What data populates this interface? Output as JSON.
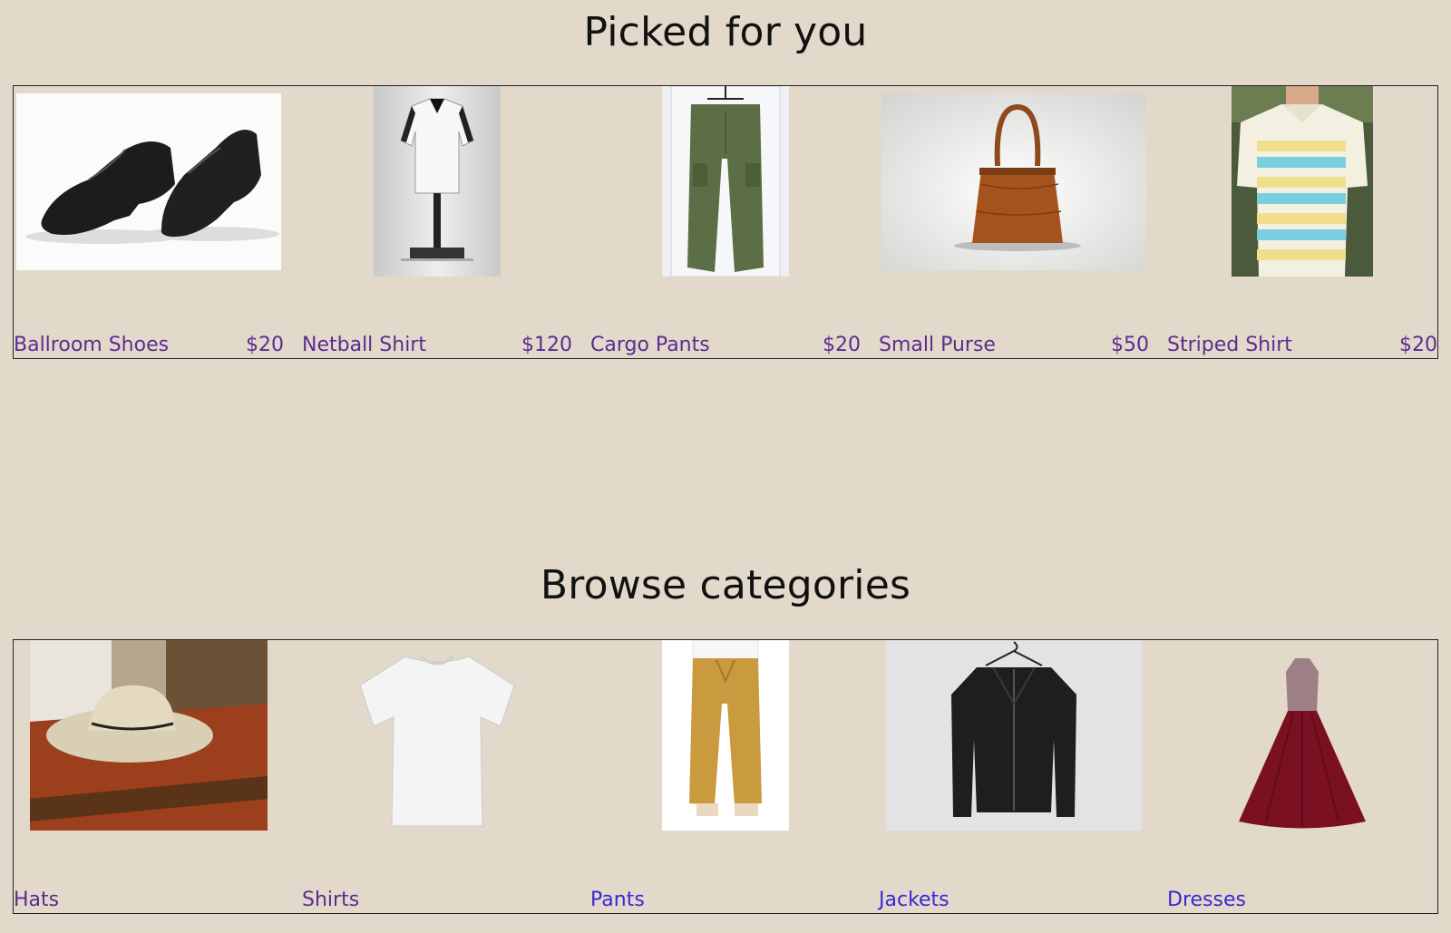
{
  "picked": {
    "title": "Picked for you",
    "items": [
      {
        "name": "Ballroom Shoes",
        "price": "$20",
        "icon": "ballroom-shoes-photo"
      },
      {
        "name": "Netball Shirt",
        "price": "$120",
        "icon": "netball-shirt-photo"
      },
      {
        "name": "Cargo Pants",
        "price": "$20",
        "icon": "cargo-pants-photo"
      },
      {
        "name": "Small Purse",
        "price": "$50",
        "icon": "small-purse-photo"
      },
      {
        "name": "Striped Shirt",
        "price": "$20",
        "icon": "striped-shirt-photo"
      }
    ]
  },
  "browse": {
    "title": "Browse categories",
    "items": [
      {
        "name": "Hats",
        "icon": "hat-photo"
      },
      {
        "name": "Shirts",
        "icon": "shirt-photo"
      },
      {
        "name": "Pants",
        "icon": "pants-photo"
      },
      {
        "name": "Jackets",
        "icon": "jacket-photo"
      },
      {
        "name": "Dresses",
        "icon": "dress-photo"
      }
    ]
  },
  "colors": {
    "background": "#e3d9ca",
    "visited_link": "#5b2d91",
    "link": "#3a26d6"
  }
}
